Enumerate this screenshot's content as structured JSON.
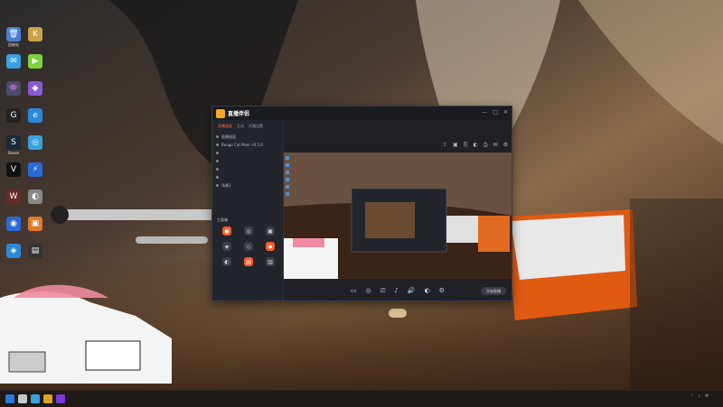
{
  "desktop": {
    "top_left_mark": "",
    "icons": [
      {
        "label": "回收站",
        "color": "#4b7fd6",
        "glyph": "🗑"
      },
      {
        "label": "",
        "color": "#c8a24a",
        "glyph": "K"
      },
      {
        "label": "",
        "color": "#3aa0e0",
        "glyph": "✉"
      },
      {
        "label": "",
        "color": "#7bd23a",
        "glyph": "▶"
      },
      {
        "label": "",
        "color": "#4a4a6a",
        "glyph": "👾"
      },
      {
        "label": "",
        "color": "#8a5ad6",
        "glyph": "◆"
      },
      {
        "label": "",
        "color": "#222",
        "glyph": "G"
      },
      {
        "label": "",
        "color": "#2a88d8",
        "glyph": "e"
      },
      {
        "label": "Steam",
        "color": "#1b2838",
        "glyph": "S"
      },
      {
        "label": "",
        "color": "#3aa0e0",
        "glyph": "◎"
      },
      {
        "label": "",
        "color": "#111",
        "glyph": "V"
      },
      {
        "label": "",
        "color": "#2a6ad8",
        "glyph": "⚡"
      },
      {
        "label": "",
        "color": "#6a2a2a",
        "glyph": "W"
      },
      {
        "label": "",
        "color": "#888",
        "glyph": "◐"
      },
      {
        "label": "",
        "color": "#2a6ad8",
        "glyph": "◉"
      },
      {
        "label": "",
        "color": "#e07a2a",
        "glyph": "▣"
      },
      {
        "label": "",
        "color": "#2a88d8",
        "glyph": "◈"
      },
      {
        "label": "",
        "color": "#333",
        "glyph": "▤"
      }
    ]
  },
  "app": {
    "name": "直播伴侣",
    "version": "",
    "window_buttons": [
      "—",
      "□",
      "✕"
    ],
    "tabs": [
      {
        "label": "直播画面",
        "active": true
      },
      {
        "label": "互动",
        "active": false
      },
      {
        "label": "开播设置",
        "active": false
      }
    ],
    "scenes": [
      {
        "label": "直播画面",
        "dim": false
      },
      {
        "label": "Bongo Cat Mver v0.1.6",
        "dim": false
      },
      {
        "label": "",
        "dim": true
      },
      {
        "label": "",
        "dim": true
      },
      {
        "label": "",
        "dim": true
      },
      {
        "label": "",
        "dim": true
      },
      {
        "label": "场景1",
        "dim": false
      }
    ],
    "tools_title": "工具箱",
    "tools": [
      {
        "label": "",
        "hot": true,
        "glyph": "●"
      },
      {
        "label": "",
        "hot": false,
        "glyph": "◎"
      },
      {
        "label": "",
        "hot": false,
        "glyph": "▣"
      },
      {
        "label": "",
        "hot": false,
        "glyph": "◈"
      },
      {
        "label": "",
        "hot": false,
        "glyph": "◇"
      },
      {
        "label": "",
        "hot": true,
        "glyph": "◆"
      },
      {
        "label": "",
        "hot": false,
        "glyph": "◐"
      },
      {
        "label": "",
        "hot": true,
        "glyph": "▤"
      },
      {
        "label": "",
        "hot": false,
        "glyph": "▥"
      }
    ],
    "footer_note": "",
    "stream_title": "",
    "stream_meta": [],
    "top_actions": [
      "⇪",
      "▣",
      "⎘",
      "◐",
      "⎙",
      "✉",
      "⚙"
    ],
    "controls": [
      {
        "label": "",
        "glyph": "▭"
      },
      {
        "label": "",
        "glyph": "◎"
      },
      {
        "label": "",
        "glyph": "⎚"
      },
      {
        "label": "",
        "glyph": "♪"
      },
      {
        "label": "",
        "glyph": "🔊"
      },
      {
        "label": "",
        "glyph": "◐"
      },
      {
        "label": "",
        "glyph": "⚙"
      }
    ],
    "start_label": "开始直播"
  },
  "chat": {
    "lines": [
      {
        "text": "",
        "hl": false
      },
      {
        "text": "",
        "hl": false
      },
      {
        "text": "",
        "hl": true
      },
      {
        "text": "",
        "hl": false
      },
      {
        "text": "",
        "hl": false
      },
      {
        "text": "",
        "hl": false
      },
      {
        "text": "",
        "hl": false
      },
      {
        "text": "",
        "hl": false
      },
      {
        "text": "",
        "hl": false
      },
      {
        "text": "",
        "hl": false
      },
      {
        "text": "",
        "hl": false
      },
      {
        "text": "",
        "hl": false
      }
    ]
  },
  "taskbar": {
    "icons": [
      "#2a7ad8",
      "#c8c8c8",
      "#3aa0e0",
      "#e0a02a",
      "#7a3ad8"
    ],
    "tray_items": [
      "^",
      "♪",
      "中"
    ],
    "time": "",
    "date": ""
  }
}
